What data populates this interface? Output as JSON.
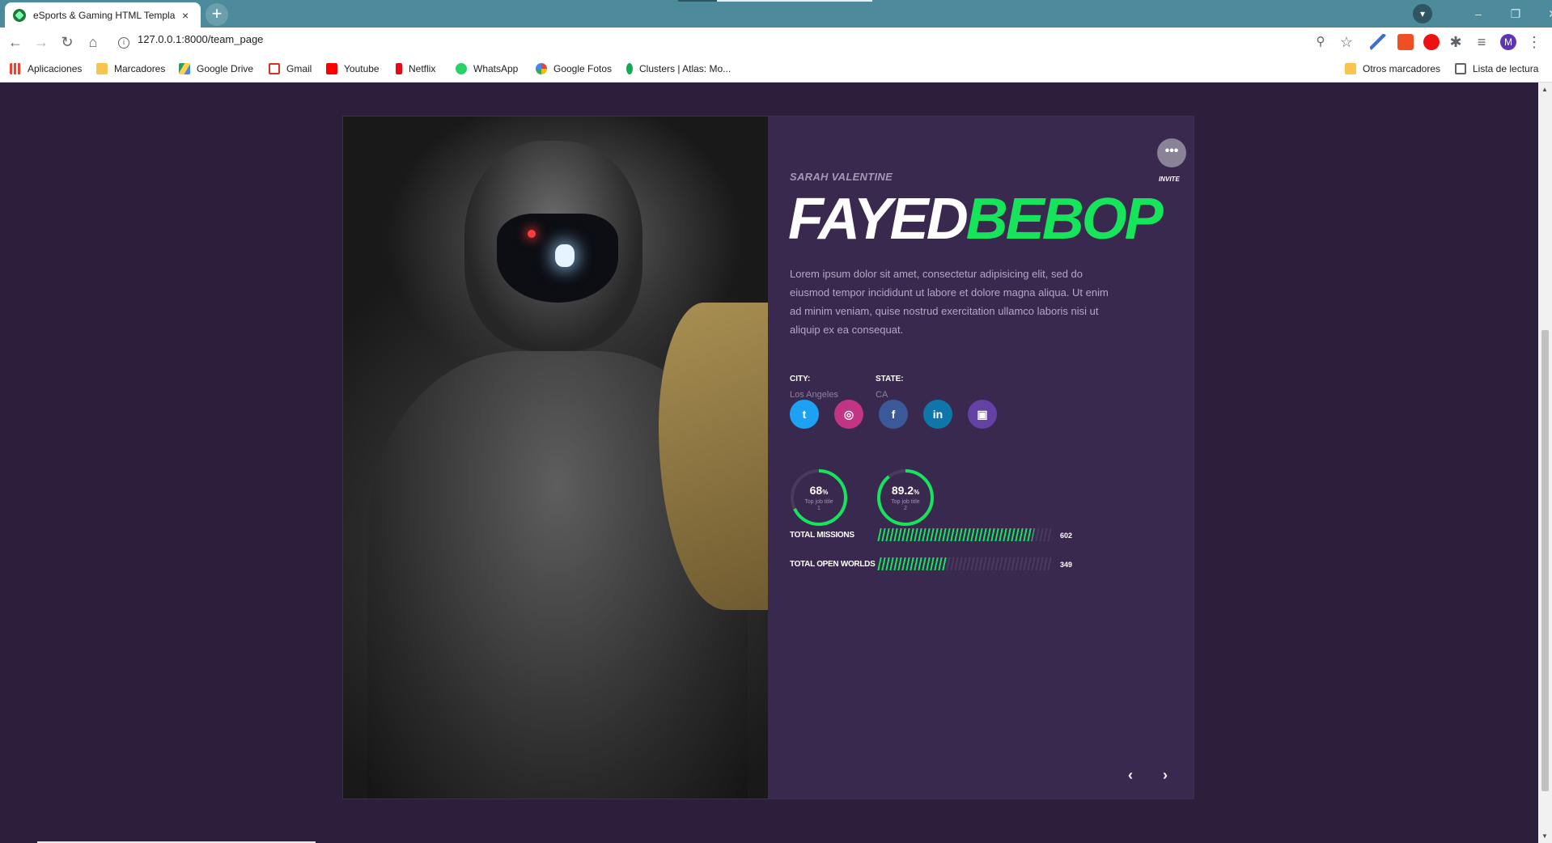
{
  "browser": {
    "tab_title": "eSports & Gaming HTML Templa",
    "tab_close": "×",
    "new_tab": "+",
    "url": "127.0.0.1:8000/team_page",
    "profile_initial": "M",
    "window_controls": [
      "–",
      "❐",
      "✕"
    ],
    "bookmarks": [
      {
        "label": "Aplicaciones",
        "color": "#e94235"
      },
      {
        "label": "Marcadores",
        "color": "#f6c44f"
      },
      {
        "label": "Google Drive",
        "color": "#1fa463"
      },
      {
        "label": "Gmail",
        "color": "#d93025"
      },
      {
        "label": "Youtube",
        "color": "#ff0000"
      },
      {
        "label": "Netflix",
        "color": "#e50914"
      },
      {
        "label": "WhatsApp",
        "color": "#25d366"
      },
      {
        "label": "Google Fotos",
        "color": "#fbbc04"
      },
      {
        "label": "Clusters | Atlas: Mo...",
        "color": "#13aa52"
      }
    ],
    "bookmarks_right": [
      {
        "label": "Otros marcadores",
        "color": "#f6c44f"
      },
      {
        "label": "Lista de lectura",
        "color": "#5f6368"
      }
    ]
  },
  "player": {
    "subtitle": "SARAH VALENTINE",
    "first_name": "FAYED",
    "last_name": "BEBOP",
    "description": "Lorem ipsum dolor sit amet, consectetur adipisicing elit, sed do eiusmod tempor incididunt ut labore et dolore magna aliqua. Ut enim ad minim veniam, quise nostrud exercitation ullamco laboris nisi ut aliquip ex ea consequat.",
    "city_label": "CITY:",
    "city": "Los Angeles",
    "state_label": "STATE:",
    "state": "CA",
    "invite_label": "INVITE",
    "invite_icon": "•••"
  },
  "socials": [
    {
      "name": "twitter",
      "glyph": "t",
      "color": "#1da1f2"
    },
    {
      "name": "instagram",
      "glyph": "◎",
      "color": "#c13584"
    },
    {
      "name": "facebook",
      "glyph": "f",
      "color": "#3b5998"
    },
    {
      "name": "linkedin",
      "glyph": "in",
      "color": "#0e76a8"
    },
    {
      "name": "twitch",
      "glyph": "▣",
      "color": "#6441a5"
    }
  ],
  "rings": [
    {
      "value": "68",
      "unit": "%",
      "caption": "Top job title 1",
      "fraction": 0.68
    },
    {
      "value": "89.2",
      "unit": "%",
      "caption": "Top job title 2",
      "fraction": 0.892
    }
  ],
  "stats": [
    {
      "label": "TOTAL MISSIONS",
      "value": "602",
      "fraction": 0.9
    },
    {
      "label": "TOTAL OPEN WORLDS",
      "value": "349",
      "fraction": 0.4
    }
  ],
  "nav": {
    "prev": "‹",
    "next": "›"
  },
  "colors": {
    "accent": "#16e55c",
    "panel": "#39294f",
    "page": "#2b1f3b"
  }
}
